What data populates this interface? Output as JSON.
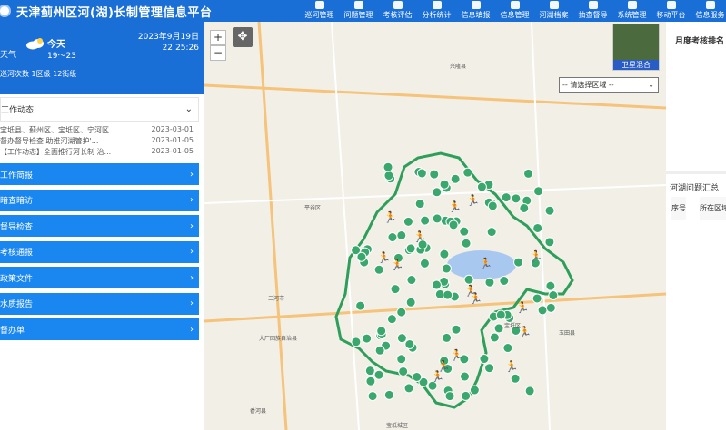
{
  "header": {
    "title": "天津蓟州区河(湖)长制管理信息平台",
    "nav": [
      "巡河管理",
      "问题管理",
      "考核评估",
      "分析统计",
      "信息填报",
      "信息管理",
      "河湖档案",
      "抽查督导",
      "系统管理",
      "移动平台",
      "信息服务"
    ]
  },
  "weather": {
    "label": "天气",
    "day": "今天",
    "temp": "19～23",
    "date": "2023年9月19日",
    "time": "22:25:26",
    "stats": "巡河次数 1区级 12街级"
  },
  "news": {
    "title": "工作动态",
    "items": [
      {
        "text": "宝坻县、蓟州区、宝坻区、宁河区...",
        "date": "2023-03-01"
      },
      {
        "text": "督办督导检查 助推河湖管护'...",
        "date": "2023-01-05"
      },
      {
        "text": "【工作动态】全面推行河长制 治...",
        "date": "2023-01-05"
      }
    ]
  },
  "menu": [
    "工作简报",
    "暗查暗访",
    "督导检查",
    "考核通报",
    "政策文件",
    "水质报告",
    "督办单"
  ],
  "map": {
    "select_placeholder": "-- 请选择区域 --",
    "satellite_label": "卫星混合",
    "zoom_in": "+",
    "zoom_out": "−",
    "labels": [
      "兴隆县",
      "平谷区",
      "三河市",
      "宝坻区",
      "玉田县",
      "蓟州区",
      "香河县",
      "宝坻城区",
      "大厂回族自治县"
    ],
    "colors": {
      "boundary": "#2e9e5b",
      "marker": "#3aa76d",
      "patrol": "#1565c0",
      "lake": "#a9c8f0"
    }
  },
  "right": {
    "title": "月度考核排名",
    "summary": "河湖问题汇总",
    "col1": "序号",
    "col2": "所在区域"
  }
}
